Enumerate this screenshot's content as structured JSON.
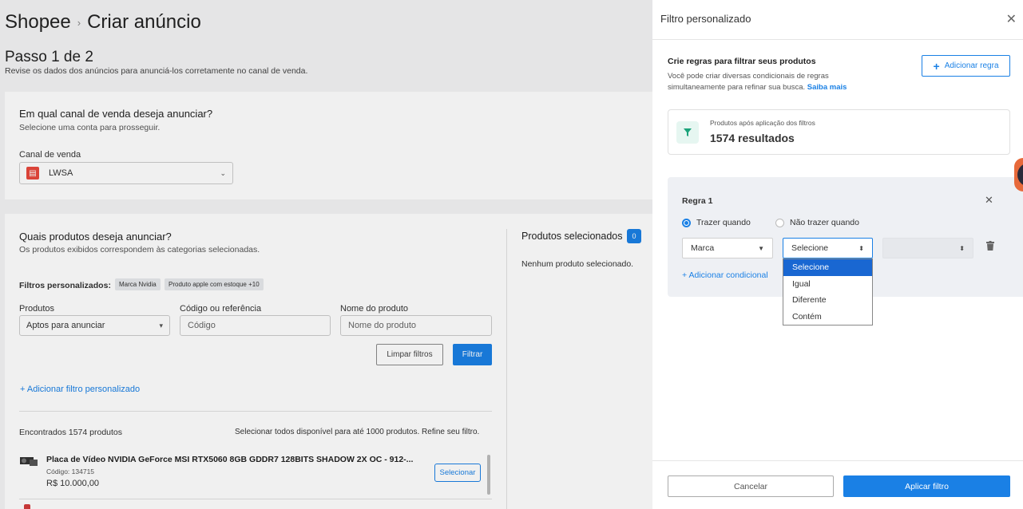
{
  "header": {
    "brand": "Shopee",
    "separator": "›",
    "title": "Criar anúncio"
  },
  "step": {
    "title": "Passo 1 de 2",
    "subtitle": "Revise os dados dos anúncios para anunciá-los corretamente no canal de venda."
  },
  "channel_section": {
    "question": "Em qual canal de venda deseja anunciar?",
    "hint": "Selecione uma conta para prosseguir.",
    "field_label": "Canal de venda",
    "selected_channel": "LWSA"
  },
  "products_section": {
    "question": "Quais produtos deseja anunciar?",
    "hint": "Os produtos exibidos correspondem às categorias selecionadas.",
    "filters_label": "Filtros personalizados:",
    "chips": [
      "Marca Nvidia",
      "Produto apple com estoque +10"
    ],
    "fields": {
      "produtos_label": "Produtos",
      "produtos_value": "Aptos para anunciar",
      "codigo_label": "Código ou referência",
      "codigo_placeholder": "Código",
      "nome_label": "Nome do produto",
      "nome_placeholder": "Nome do produto"
    },
    "clear_button": "Limpar filtros",
    "filter_button": "Filtrar",
    "add_filter_link": "+ Adicionar filtro personalizado",
    "found_text": "Encontrados 1574 produtos",
    "select_all_text": "Selecionar todos disponível para até 1000 produtos. Refine seu filtro.",
    "items": [
      {
        "title": "Placa de Vídeo NVIDIA GeForce MSI RTX5060 8GB GDDR7 128BITS SHADOW 2X OC - 912-...",
        "code": "Código: 134715",
        "price": "R$ 10.000,00",
        "button": "Selecionar"
      }
    ]
  },
  "selected_panel": {
    "title": "Produtos selecionados",
    "count": "0",
    "empty": "Nenhum produto selecionado."
  },
  "drawer": {
    "title": "Filtro personalizado",
    "heading": "Crie regras para filtrar seus produtos",
    "description": "Você pode criar diversas condicionais de regras simultaneamente para refinar sua busca.",
    "more_link": "Saiba mais",
    "add_rule_button": "Adicionar regra",
    "results_label": "Produtos após aplicação dos filtros",
    "results_value": "1574 resultados",
    "rule": {
      "title": "Regra 1",
      "radio_include": "Trazer quando",
      "radio_exclude": "Não trazer quando",
      "field_value": "Marca",
      "operator_value": "Selecione",
      "add_condition": "+ Adicionar condicional"
    },
    "operator_options": [
      "Selecione",
      "Igual",
      "Diferente",
      "Contém"
    ],
    "cancel_button": "Cancelar",
    "apply_button": "Aplicar filtro"
  },
  "colors": {
    "primary": "#1a80e5",
    "dropdown_highlight": "#1967d2",
    "store_icon": "#e8483c",
    "accent_teal": "#1aa37a"
  }
}
